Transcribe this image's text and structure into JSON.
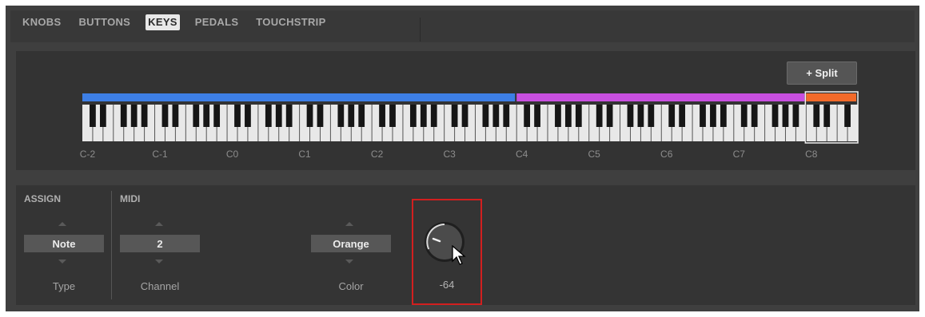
{
  "tabs": [
    {
      "label": "KNOBS",
      "active": false
    },
    {
      "label": "BUTTONS",
      "active": false
    },
    {
      "label": "KEYS",
      "active": true
    },
    {
      "label": "PEDALS",
      "active": false
    },
    {
      "label": "TOUCHSTRIP",
      "active": false
    }
  ],
  "keyboard": {
    "split_button": "+ Split",
    "octave_labels": [
      "C-2",
      "C-1",
      "C0",
      "C1",
      "C2",
      "C3",
      "C4",
      "C5",
      "C6",
      "C7",
      "C8"
    ],
    "zones": [
      {
        "color": "#3d7fe6",
        "selected": false
      },
      {
        "color": "#c84fe0",
        "selected": false
      },
      {
        "color": "#f26a2a",
        "selected": true
      }
    ]
  },
  "assign": {
    "title": "ASSIGN",
    "type_value": "Note",
    "type_label": "Type"
  },
  "midi": {
    "title": "MIDI",
    "channel_value": "2",
    "channel_label": "Channel",
    "color_value": "Orange",
    "color_label": "Color",
    "knob_value": "-64",
    "knob_level": 0
  },
  "colors": {
    "highlight": "#d21f1f",
    "active_tab": "#e8e8e8"
  }
}
